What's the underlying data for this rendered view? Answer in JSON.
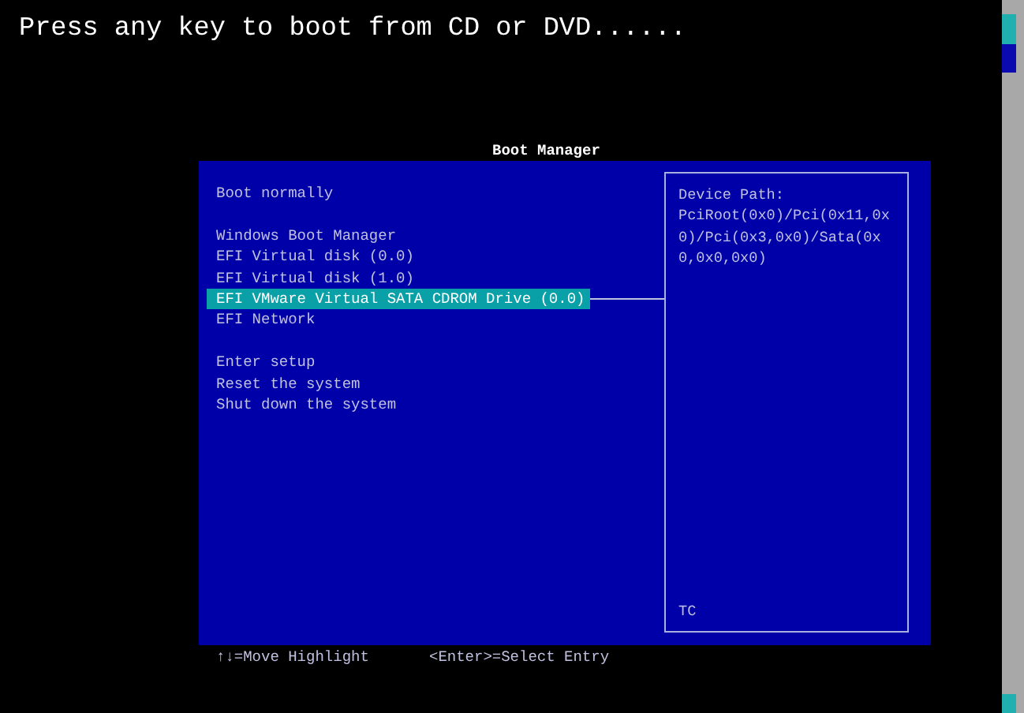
{
  "console_message": "Press any key to boot from CD or DVD......",
  "boot_manager": {
    "title": "Boot Manager",
    "menu_groups": [
      [
        {
          "label": "Boot normally",
          "selected": false
        }
      ],
      [
        {
          "label": "Windows Boot Manager",
          "selected": false
        },
        {
          "label": "EFI Virtual disk (0.0)",
          "selected": false
        },
        {
          "label": "EFI Virtual disk (1.0)",
          "selected": false
        },
        {
          "label": "EFI VMware Virtual SATA CDROM Drive (0.0)",
          "selected": true
        },
        {
          "label": "EFI Network",
          "selected": false
        }
      ],
      [
        {
          "label": "Enter setup",
          "selected": false
        },
        {
          "label": "Reset the system",
          "selected": false
        },
        {
          "label": "Shut down the system",
          "selected": false
        }
      ]
    ],
    "help_panel": {
      "heading": "Device Path:",
      "path": "PciRoot(0x0)/Pci(0x11,0x0)/Pci(0x3,0x0)/Sata(0x0,0x0,0x0)",
      "footer": "TC"
    }
  },
  "key_hints": [
    "↑↓=Move Highlight",
    "<Enter>=Select Entry"
  ]
}
